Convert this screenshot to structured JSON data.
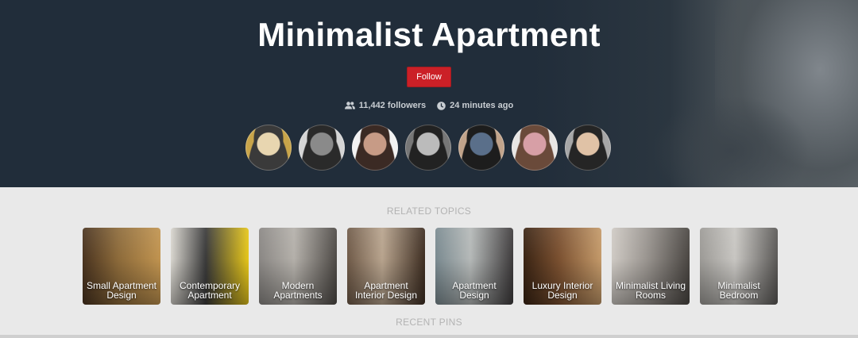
{
  "board": {
    "title": "Minimalist Apartment",
    "follow_label": "Follow",
    "followers_text": "11,442 followers",
    "updated_text": "24 minutes ago"
  },
  "followers": [
    {
      "name": "follower-1",
      "colors": [
        "#c9a54a",
        "#3a3a3a",
        "#e8d6b0"
      ]
    },
    {
      "name": "follower-2",
      "colors": [
        "#d5d5d5",
        "#2a2a2a",
        "#8a8a8a"
      ]
    },
    {
      "name": "follower-3",
      "colors": [
        "#f2f2f2",
        "#3b2a24",
        "#c79b86"
      ]
    },
    {
      "name": "follower-4",
      "colors": [
        "#777777",
        "#222222",
        "#bbbbbb"
      ]
    },
    {
      "name": "follower-5",
      "colors": [
        "#c2a48b",
        "#1d1d1d",
        "#5a6f8a"
      ]
    },
    {
      "name": "follower-6",
      "colors": [
        "#e8e6e4",
        "#6a4a3a",
        "#d79fa6"
      ]
    },
    {
      "name": "follower-7",
      "colors": [
        "#a7a7a7",
        "#252525",
        "#e0c2a6"
      ]
    }
  ],
  "sections": {
    "related": "RELATED TOPICS",
    "recent": "RECENT PINS"
  },
  "topics": [
    {
      "label": "Small Apartment Design",
      "colors": [
        "#4a3420",
        "#8c6a3a",
        "#c19450"
      ]
    },
    {
      "label": "Contemporary Apartment",
      "colors": [
        "#d9d6cf",
        "#3a3a3a",
        "#e6c61a"
      ]
    },
    {
      "label": "Modern Apartments",
      "colors": [
        "#8a8784",
        "#b4b0aa",
        "#4e4a46"
      ]
    },
    {
      "label": "Apartment Interior Design",
      "colors": [
        "#6f5a48",
        "#b8a48e",
        "#3e2e22"
      ]
    },
    {
      "label": "Apartment Design",
      "colors": [
        "#7a8a90",
        "#b5b9b8",
        "#3e3b3c"
      ]
    },
    {
      "label": "Luxury Interior Design",
      "colors": [
        "#3a2414",
        "#7a5030",
        "#c49a6a"
      ]
    },
    {
      "label": "Minimalist Living Rooms",
      "colors": [
        "#cfcac4",
        "#9a9590",
        "#4a4642"
      ]
    },
    {
      "label": "Minimalist Bedroom",
      "colors": [
        "#9c9a96",
        "#c8c6c2",
        "#5a5856"
      ]
    }
  ]
}
